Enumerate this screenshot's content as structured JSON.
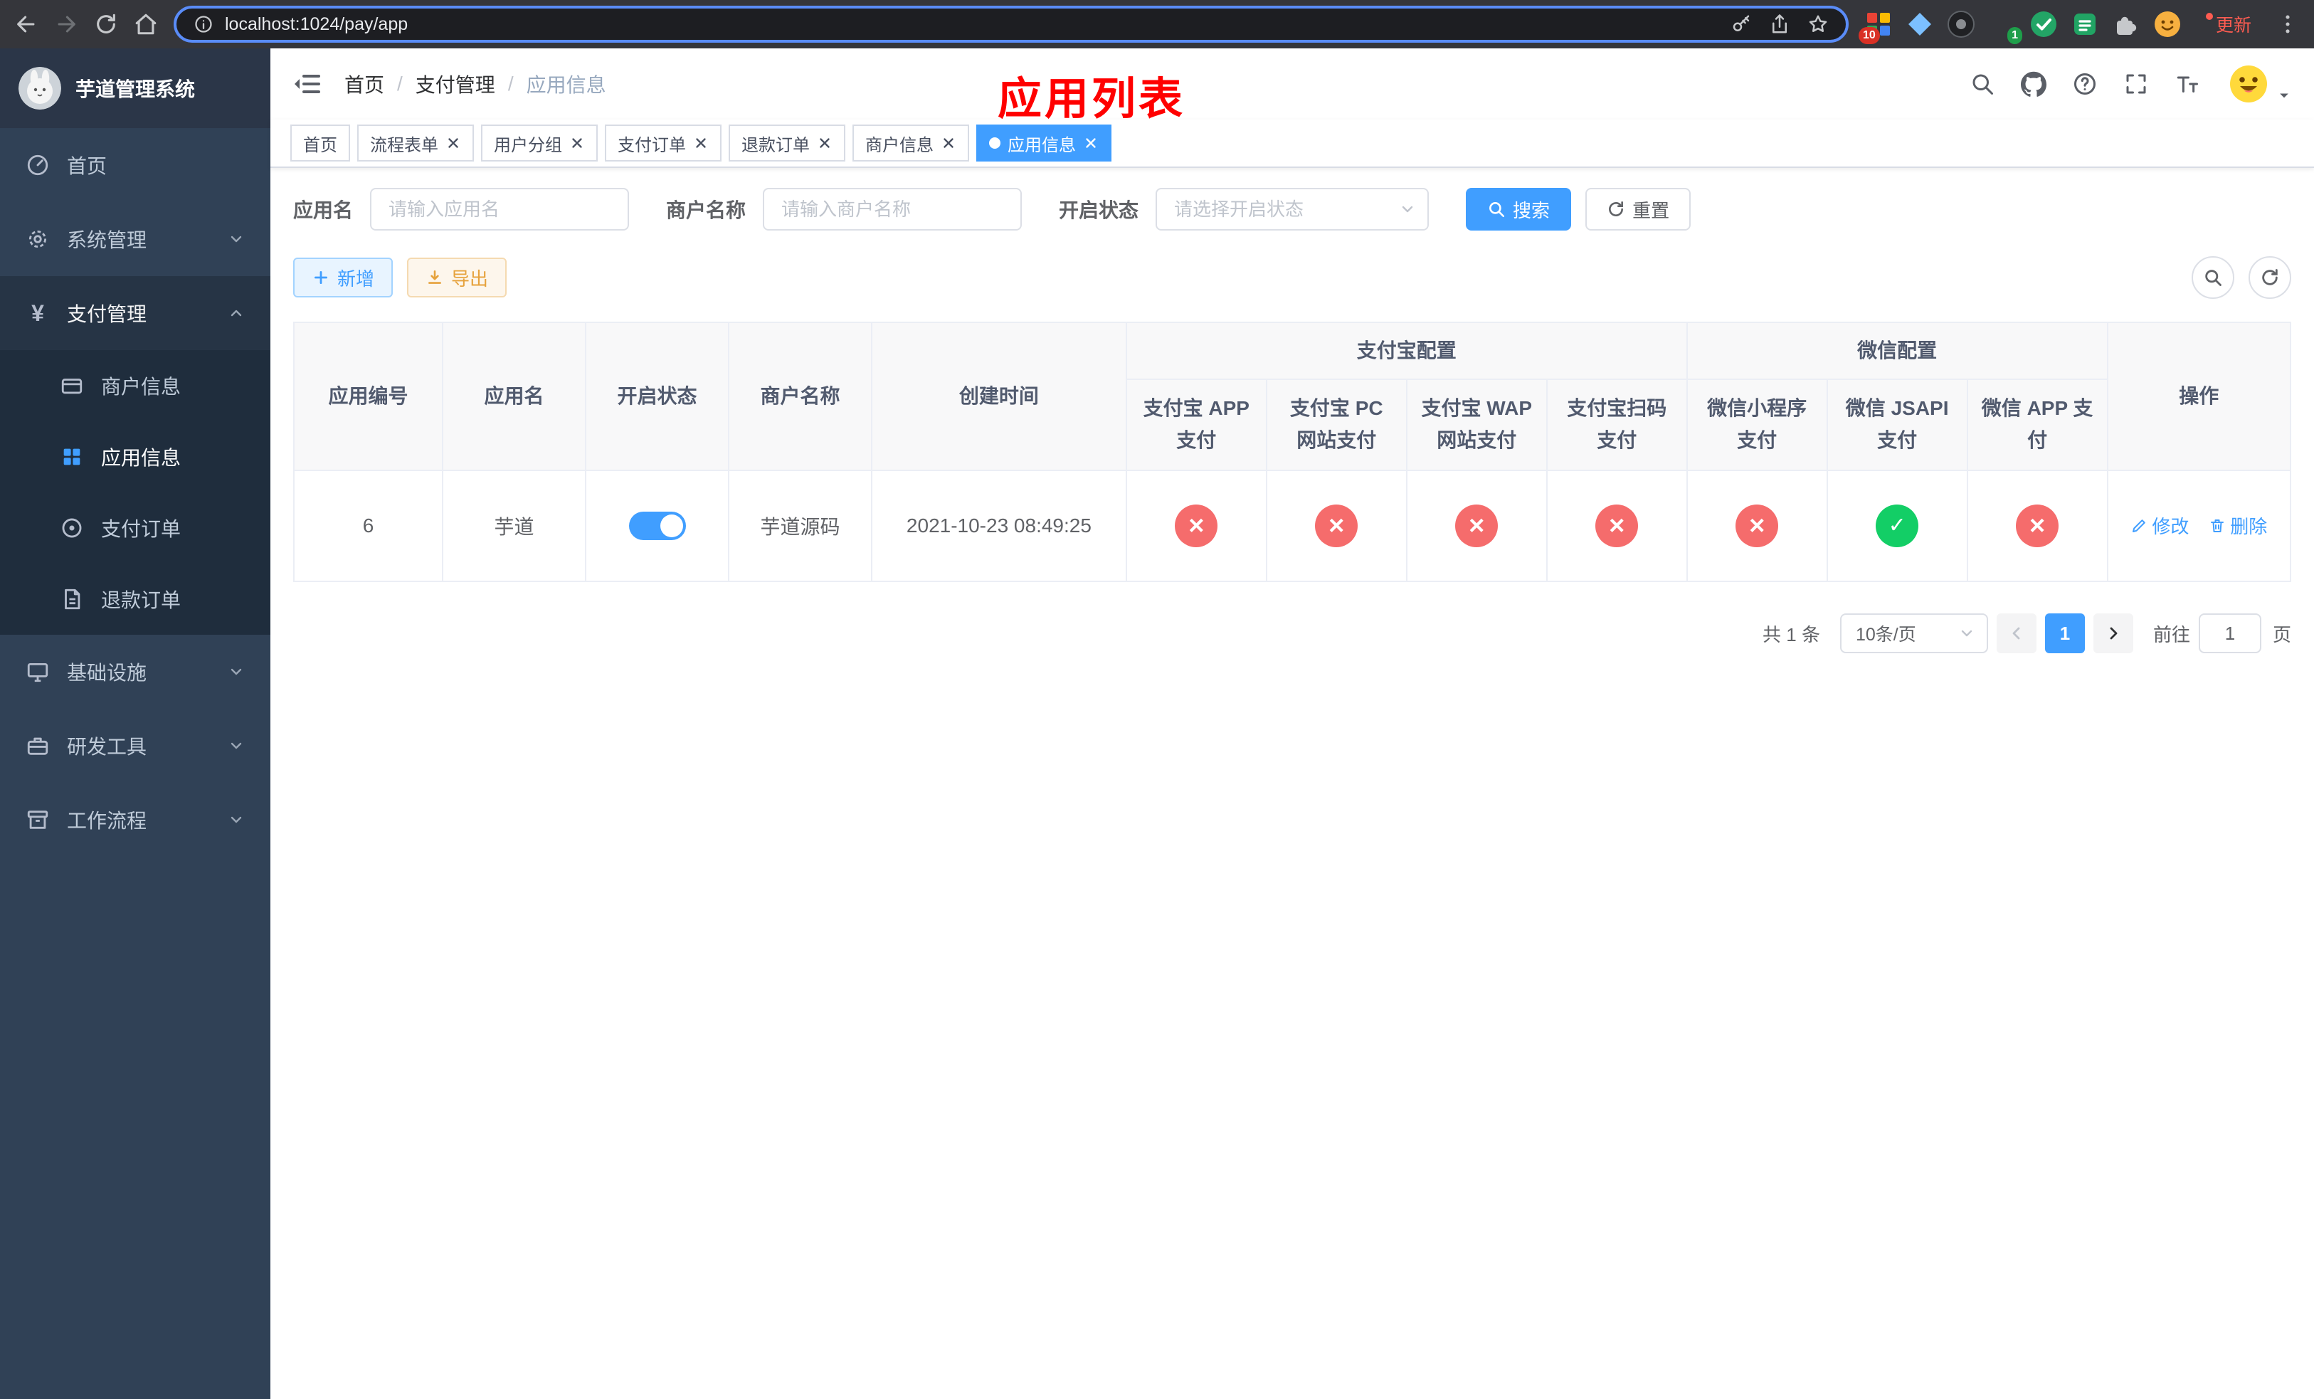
{
  "colors": {
    "accent": "#409eff",
    "danger": "#f56c6c",
    "success": "#13ce66",
    "warning": "#e6a23c",
    "annotation": "#ff0000"
  },
  "browser": {
    "url": "localhost:1024/pay/app",
    "update_label": "更新",
    "ext_badge_a": "10",
    "ext_badge_b": "1"
  },
  "sidebar": {
    "title": "芋道管理系统",
    "items": [
      {
        "label": "首页"
      },
      {
        "label": "系统管理"
      },
      {
        "label": "支付管理"
      },
      {
        "label": "商户信息"
      },
      {
        "label": "应用信息"
      },
      {
        "label": "支付订单"
      },
      {
        "label": "退款订单"
      },
      {
        "label": "基础设施"
      },
      {
        "label": "研发工具"
      },
      {
        "label": "工作流程"
      }
    ]
  },
  "header": {
    "breadcrumb": [
      "首页",
      "支付管理",
      "应用信息"
    ],
    "annotation": "应用列表"
  },
  "tabs": [
    {
      "label": "首页"
    },
    {
      "label": "流程表单"
    },
    {
      "label": "用户分组"
    },
    {
      "label": "支付订单"
    },
    {
      "label": "退款订单"
    },
    {
      "label": "商户信息"
    },
    {
      "label": "应用信息"
    }
  ],
  "filters": {
    "app_name_label": "应用名",
    "app_name_placeholder": "请输入应用名",
    "merchant_label": "商户名称",
    "merchant_placeholder": "请输入商户名称",
    "status_label": "开启状态",
    "status_placeholder": "请选择开启状态",
    "search_label": "搜索",
    "reset_label": "重置"
  },
  "toolbar": {
    "add_label": "新增",
    "export_label": "导出"
  },
  "table": {
    "groups": {
      "alipay": "支付宝配置",
      "wechat": "微信配置"
    },
    "headers": {
      "app_id": "应用编号",
      "app_name": "应用名",
      "status": "开启状态",
      "merchant": "商户名称",
      "created": "创建时间",
      "alipay_app": "支付宝 APP 支付",
      "alipay_pc": "支付宝 PC 网站支付",
      "alipay_wap": "支付宝 WAP 网站支付",
      "alipay_qr": "支付宝扫码支付",
      "wx_mini": "微信小程序支付",
      "wx_jsapi": "微信 JSAPI 支付",
      "wx_app": "微信 APP 支付",
      "actions": "操作"
    },
    "row": {
      "app_id": "6",
      "app_name": "芋道",
      "status": "on",
      "merchant": "芋道源码",
      "created": "2021-10-23 08:49:25",
      "configs": [
        "fail",
        "fail",
        "fail",
        "fail",
        "fail",
        "success",
        "fail"
      ],
      "edit_label": "修改",
      "delete_label": "删除"
    }
  },
  "pagination": {
    "total": "共 1 条",
    "page_size": "10条/页",
    "page": "1",
    "goto_label": "前往",
    "goto_value": "1",
    "page_suffix": "页"
  }
}
